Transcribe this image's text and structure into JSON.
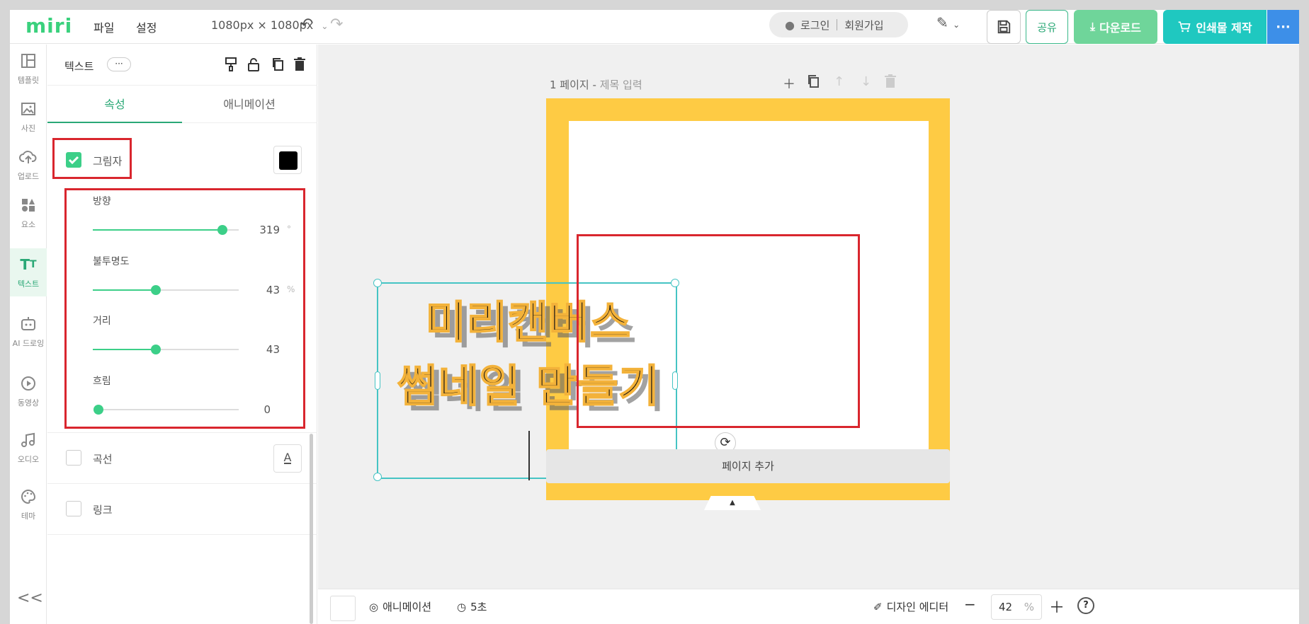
{
  "header": {
    "logo": "miri",
    "menu_file": "파일",
    "menu_settings": "설정",
    "canvas_size": "1080px × 1080px",
    "login": "로그인",
    "signup": "회원가입",
    "share": "공유",
    "download": "다운로드",
    "print": "인쇄물 제작",
    "more": "···"
  },
  "sidebar": {
    "items": [
      {
        "label": "템플릿",
        "icon": "template-icon"
      },
      {
        "label": "사진",
        "icon": "photo-icon"
      },
      {
        "label": "업로드",
        "icon": "upload-icon"
      },
      {
        "label": "요소",
        "icon": "elements-icon"
      },
      {
        "label": "텍스트",
        "icon": "text-icon"
      },
      {
        "label": "AI 드로잉",
        "icon": "ai-drawing-icon"
      },
      {
        "label": "동영상",
        "icon": "video-icon"
      },
      {
        "label": "오디오",
        "icon": "audio-icon"
      },
      {
        "label": "테마",
        "icon": "palette-icon"
      }
    ],
    "active_index": 4,
    "collapse": "<<"
  },
  "panel": {
    "title": "텍스트",
    "more": "···",
    "tabs": [
      "속성",
      "애니메이션"
    ],
    "active_tab": 0,
    "shadow": {
      "label": "그림자",
      "checked": true,
      "color": "#000000",
      "sliders": [
        {
          "label": "방향",
          "value": "319",
          "unit": "°",
          "fraction": 0.89
        },
        {
          "label": "불투명도",
          "value": "43",
          "unit": "%",
          "fraction": 0.43
        },
        {
          "label": "거리",
          "value": "43",
          "unit": "",
          "fraction": 0.43
        },
        {
          "label": "흐림",
          "value": "0",
          "unit": "",
          "fraction": 0.0
        }
      ]
    },
    "curve": {
      "label": "곡선",
      "checked": false,
      "button": "A"
    },
    "link": {
      "label": "링크",
      "checked": false
    }
  },
  "canvas": {
    "page_label": "1 페이지 -",
    "page_title_placeholder": "제목 입력",
    "text_line1": "미리캔버스",
    "text_line2": "썸네일 만들기",
    "add_page": "페이지 추가",
    "page_color": "#fecb44"
  },
  "footer": {
    "animation": "애니메이션",
    "duration": "5초",
    "design_editor": "디자인 에디터",
    "zoom": "42",
    "zoom_unit": "%",
    "help": "?"
  }
}
